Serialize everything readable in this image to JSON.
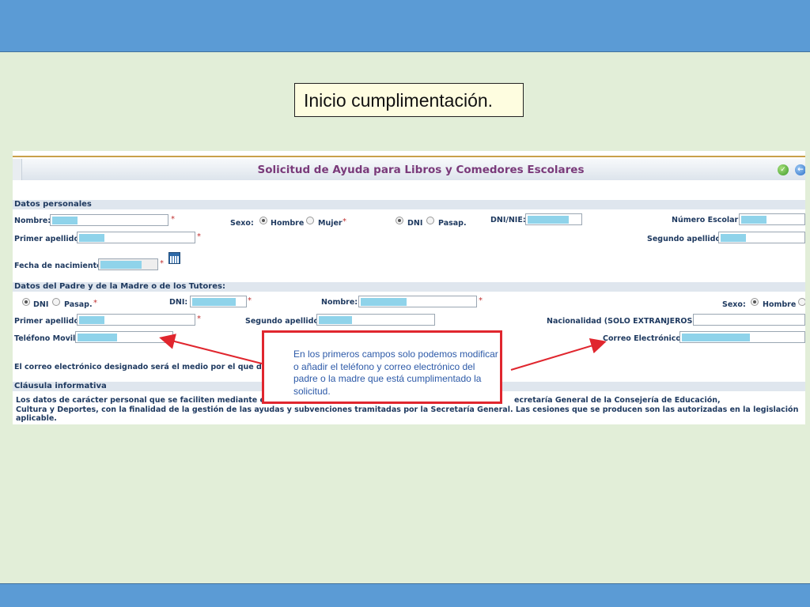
{
  "slide": {
    "title": "Inicio cumplimentación.",
    "callout": "En los primeros campos solo podemos modificar o añadir el teléfono y correo electrónico del padre o la madre que está cumplimentado la solicitud."
  },
  "form": {
    "title": "Solicitud de Ayuda para Libros y Comedores Escolares",
    "personal": {
      "section": "Datos personales",
      "nombre": "Nombre:",
      "sexo": "Sexo:",
      "hombre": "Hombre",
      "mujer": "Mujer",
      "dni": "DNI",
      "pasap": "Pasap.",
      "dni_nie": "DNI/NIE:",
      "numero_escolar": "Número Escolar:",
      "primer_apellido": "Primer apellido:",
      "segundo_apellido": "Segundo apellido:",
      "fecha_nacimiento": "Fecha de nacimiento:"
    },
    "parents": {
      "section": "Datos del Padre y de la Madre o de los Tutores:",
      "dni": "DNI",
      "pasap": "Pasap.",
      "dni_label": "DNI:",
      "nombre": "Nombre:",
      "sexo": "Sexo:",
      "hombre": "Hombre",
      "primer_apellido": "Primer apellido:",
      "segundo_apellido": "Segundo apellido:",
      "nacionalidad": "Nacionalidad (SOLO EXTRANJEROS):",
      "telefono": "Teléfono Movil:",
      "correo": "Correo Electrónico:",
      "email_note": "El correo electrónico designado será el medio por el que desea re"
    },
    "clausula": {
      "section": "Cláusula informativa",
      "line1a": "Los datos de carácter personal que se faciliten mediante este for",
      "line1b": "ecretaría General de la Consejería de Educación,",
      "line2": "Cultura y Deportes, con la finalidad de la gestión de las ayudas y subvenciones tramitadas por la Secretaría General. Las cesiones que se producen son las autorizadas en la legislación",
      "line3": "aplicable."
    },
    "required_mark": "*"
  },
  "colors": {
    "bar": "#5b9bd5",
    "background": "#e2eed8",
    "callout_border": "#e0262e",
    "callout_text": "#2d5aa8",
    "form_title": "#7a3a7a",
    "redacted_fill": "#8fd3ea"
  }
}
